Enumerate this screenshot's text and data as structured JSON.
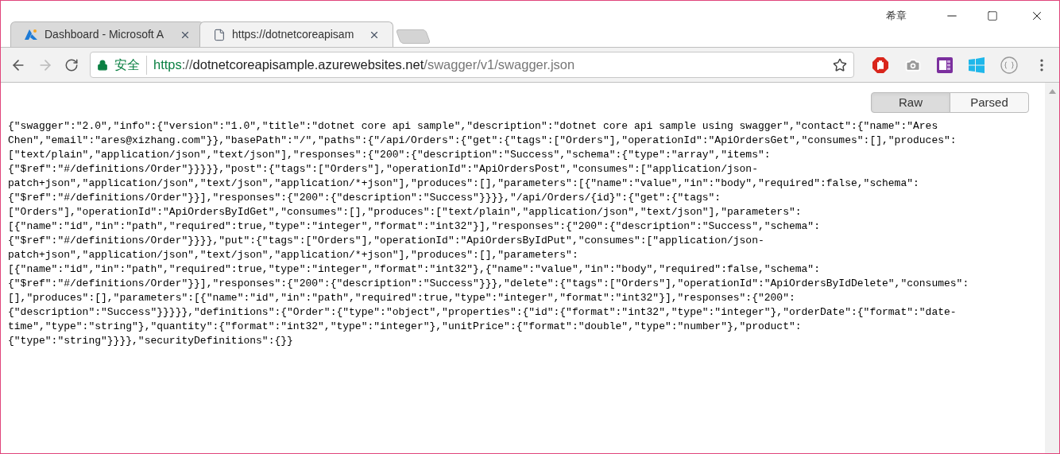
{
  "window": {
    "user": "希章"
  },
  "tabs": [
    {
      "title": "Dashboard - Microsoft A",
      "kind": "azure",
      "selected": false
    },
    {
      "title": "https://dotnetcoreapisam",
      "kind": "page",
      "selected": true
    }
  ],
  "address_bar": {
    "security": "安全",
    "url_host": "https://dotnetcoreapisample.azurewebsites.net",
    "url_path": "/swagger/v1/swagger.json"
  },
  "view_toggle": [
    {
      "label": "Raw",
      "selected": true
    },
    {
      "label": "Parsed",
      "selected": false
    }
  ],
  "json_lines": [
    "{\"swagger\":\"2.0\",\"info\":{\"version\":\"1.0\",\"title\":\"dotnet core api sample\",\"description\":\"dotnet core api sample using swagger\",\"contact\":{\"name\":\"Ares",
    "Chen\",\"email\":\"ares@xizhang.com\"}},\"basePath\":\"/\",\"paths\":{\"/api/Orders\":{\"get\":{\"tags\":[\"Orders\"],\"operationId\":\"ApiOrdersGet\",\"consumes\":[],\"produces\":",
    "[\"text/plain\",\"application/json\",\"text/json\"],\"responses\":{\"200\":{\"description\":\"Success\",\"schema\":{\"type\":\"array\",\"items\":",
    "{\"$ref\":\"#/definitions/Order\"}}}}},\"post\":{\"tags\":[\"Orders\"],\"operationId\":\"ApiOrdersPost\",\"consumes\":[\"application/json-",
    "patch+json\",\"application/json\",\"text/json\",\"application/*+json\"],\"produces\":[],\"parameters\":[{\"name\":\"value\",\"in\":\"body\",\"required\":false,\"schema\":",
    "{\"$ref\":\"#/definitions/Order\"}}],\"responses\":{\"200\":{\"description\":\"Success\"}}}},\"/api/Orders/{id}\":{\"get\":{\"tags\":",
    "[\"Orders\"],\"operationId\":\"ApiOrdersByIdGet\",\"consumes\":[],\"produces\":[\"text/plain\",\"application/json\",\"text/json\"],\"parameters\":",
    "[{\"name\":\"id\",\"in\":\"path\",\"required\":true,\"type\":\"integer\",\"format\":\"int32\"}],\"responses\":{\"200\":{\"description\":\"Success\",\"schema\":",
    "{\"$ref\":\"#/definitions/Order\"}}}},\"put\":{\"tags\":[\"Orders\"],\"operationId\":\"ApiOrdersByIdPut\",\"consumes\":[\"application/json-",
    "patch+json\",\"application/json\",\"text/json\",\"application/*+json\"],\"produces\":[],\"parameters\":",
    "[{\"name\":\"id\",\"in\":\"path\",\"required\":true,\"type\":\"integer\",\"format\":\"int32\"},{\"name\":\"value\",\"in\":\"body\",\"required\":false,\"schema\":",
    "{\"$ref\":\"#/definitions/Order\"}}],\"responses\":{\"200\":{\"description\":\"Success\"}}},\"delete\":{\"tags\":[\"Orders\"],\"operationId\":\"ApiOrdersByIdDelete\",\"consumes\":",
    "[],\"produces\":[],\"parameters\":[{\"name\":\"id\",\"in\":\"path\",\"required\":true,\"type\":\"integer\",\"format\":\"int32\"}],\"responses\":{\"200\":",
    "{\"description\":\"Success\"}}}}},\"definitions\":{\"Order\":{\"type\":\"object\",\"properties\":{\"id\":{\"format\":\"int32\",\"type\":\"integer\"},\"orderDate\":{\"format\":\"date-",
    "time\",\"type\":\"string\"},\"quantity\":{\"format\":\"int32\",\"type\":\"integer\"},\"unitPrice\":{\"format\":\"double\",\"type\":\"number\"},\"product\":",
    "{\"type\":\"string\"}}}},\"securityDefinitions\":{}}"
  ]
}
